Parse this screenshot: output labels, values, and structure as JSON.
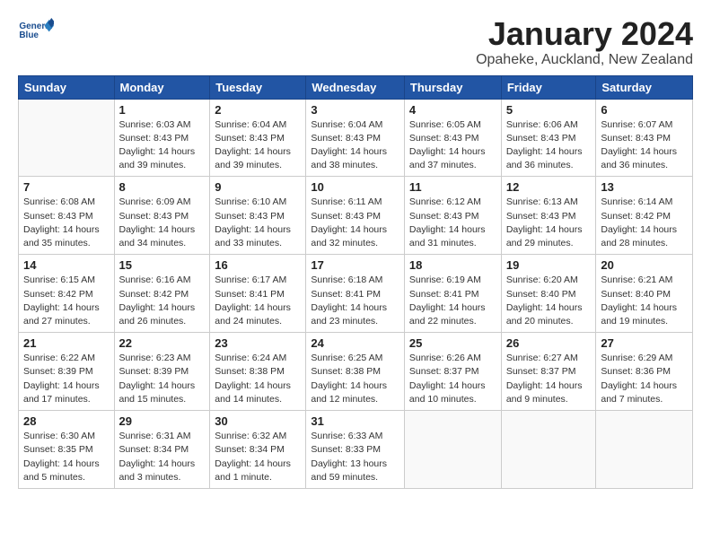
{
  "header": {
    "logo_line1": "General",
    "logo_line2": "Blue",
    "title": "January 2024",
    "subtitle": "Opaheke, Auckland, New Zealand"
  },
  "days_of_week": [
    "Sunday",
    "Monday",
    "Tuesday",
    "Wednesday",
    "Thursday",
    "Friday",
    "Saturday"
  ],
  "weeks": [
    {
      "days": [
        {
          "num": "",
          "info": ""
        },
        {
          "num": "1",
          "info": "Sunrise: 6:03 AM\nSunset: 8:43 PM\nDaylight: 14 hours\nand 39 minutes."
        },
        {
          "num": "2",
          "info": "Sunrise: 6:04 AM\nSunset: 8:43 PM\nDaylight: 14 hours\nand 39 minutes."
        },
        {
          "num": "3",
          "info": "Sunrise: 6:04 AM\nSunset: 8:43 PM\nDaylight: 14 hours\nand 38 minutes."
        },
        {
          "num": "4",
          "info": "Sunrise: 6:05 AM\nSunset: 8:43 PM\nDaylight: 14 hours\nand 37 minutes."
        },
        {
          "num": "5",
          "info": "Sunrise: 6:06 AM\nSunset: 8:43 PM\nDaylight: 14 hours\nand 36 minutes."
        },
        {
          "num": "6",
          "info": "Sunrise: 6:07 AM\nSunset: 8:43 PM\nDaylight: 14 hours\nand 36 minutes."
        }
      ]
    },
    {
      "days": [
        {
          "num": "7",
          "info": "Sunrise: 6:08 AM\nSunset: 8:43 PM\nDaylight: 14 hours\nand 35 minutes."
        },
        {
          "num": "8",
          "info": "Sunrise: 6:09 AM\nSunset: 8:43 PM\nDaylight: 14 hours\nand 34 minutes."
        },
        {
          "num": "9",
          "info": "Sunrise: 6:10 AM\nSunset: 8:43 PM\nDaylight: 14 hours\nand 33 minutes."
        },
        {
          "num": "10",
          "info": "Sunrise: 6:11 AM\nSunset: 8:43 PM\nDaylight: 14 hours\nand 32 minutes."
        },
        {
          "num": "11",
          "info": "Sunrise: 6:12 AM\nSunset: 8:43 PM\nDaylight: 14 hours\nand 31 minutes."
        },
        {
          "num": "12",
          "info": "Sunrise: 6:13 AM\nSunset: 8:43 PM\nDaylight: 14 hours\nand 29 minutes."
        },
        {
          "num": "13",
          "info": "Sunrise: 6:14 AM\nSunset: 8:42 PM\nDaylight: 14 hours\nand 28 minutes."
        }
      ]
    },
    {
      "days": [
        {
          "num": "14",
          "info": "Sunrise: 6:15 AM\nSunset: 8:42 PM\nDaylight: 14 hours\nand 27 minutes."
        },
        {
          "num": "15",
          "info": "Sunrise: 6:16 AM\nSunset: 8:42 PM\nDaylight: 14 hours\nand 26 minutes."
        },
        {
          "num": "16",
          "info": "Sunrise: 6:17 AM\nSunset: 8:41 PM\nDaylight: 14 hours\nand 24 minutes."
        },
        {
          "num": "17",
          "info": "Sunrise: 6:18 AM\nSunset: 8:41 PM\nDaylight: 14 hours\nand 23 minutes."
        },
        {
          "num": "18",
          "info": "Sunrise: 6:19 AM\nSunset: 8:41 PM\nDaylight: 14 hours\nand 22 minutes."
        },
        {
          "num": "19",
          "info": "Sunrise: 6:20 AM\nSunset: 8:40 PM\nDaylight: 14 hours\nand 20 minutes."
        },
        {
          "num": "20",
          "info": "Sunrise: 6:21 AM\nSunset: 8:40 PM\nDaylight: 14 hours\nand 19 minutes."
        }
      ]
    },
    {
      "days": [
        {
          "num": "21",
          "info": "Sunrise: 6:22 AM\nSunset: 8:39 PM\nDaylight: 14 hours\nand 17 minutes."
        },
        {
          "num": "22",
          "info": "Sunrise: 6:23 AM\nSunset: 8:39 PM\nDaylight: 14 hours\nand 15 minutes."
        },
        {
          "num": "23",
          "info": "Sunrise: 6:24 AM\nSunset: 8:38 PM\nDaylight: 14 hours\nand 14 minutes."
        },
        {
          "num": "24",
          "info": "Sunrise: 6:25 AM\nSunset: 8:38 PM\nDaylight: 14 hours\nand 12 minutes."
        },
        {
          "num": "25",
          "info": "Sunrise: 6:26 AM\nSunset: 8:37 PM\nDaylight: 14 hours\nand 10 minutes."
        },
        {
          "num": "26",
          "info": "Sunrise: 6:27 AM\nSunset: 8:37 PM\nDaylight: 14 hours\nand 9 minutes."
        },
        {
          "num": "27",
          "info": "Sunrise: 6:29 AM\nSunset: 8:36 PM\nDaylight: 14 hours\nand 7 minutes."
        }
      ]
    },
    {
      "days": [
        {
          "num": "28",
          "info": "Sunrise: 6:30 AM\nSunset: 8:35 PM\nDaylight: 14 hours\nand 5 minutes."
        },
        {
          "num": "29",
          "info": "Sunrise: 6:31 AM\nSunset: 8:34 PM\nDaylight: 14 hours\nand 3 minutes."
        },
        {
          "num": "30",
          "info": "Sunrise: 6:32 AM\nSunset: 8:34 PM\nDaylight: 14 hours\nand 1 minute."
        },
        {
          "num": "31",
          "info": "Sunrise: 6:33 AM\nSunset: 8:33 PM\nDaylight: 13 hours\nand 59 minutes."
        },
        {
          "num": "",
          "info": ""
        },
        {
          "num": "",
          "info": ""
        },
        {
          "num": "",
          "info": ""
        }
      ]
    }
  ]
}
